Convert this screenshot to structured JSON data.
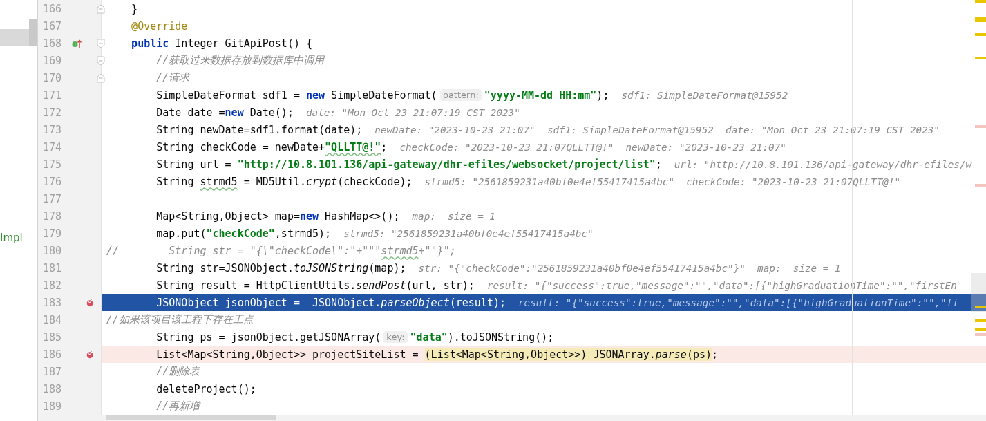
{
  "side_panel": {
    "label": "Impl"
  },
  "lines": [
    {
      "number": "166",
      "override": false,
      "breakpoint": false,
      "current": false,
      "fold_start": false,
      "fold_end": true,
      "tokens": [
        {
          "kind": "plain",
          "text": "    }"
        }
      ]
    },
    {
      "number": "167",
      "override": false,
      "breakpoint": false,
      "current": false,
      "fold_start": false,
      "fold_end": false,
      "tokens": [
        {
          "kind": "annotation",
          "text": "    @Override"
        }
      ]
    },
    {
      "number": "168",
      "override": true,
      "breakpoint": false,
      "current": false,
      "fold_start": true,
      "fold_end": false,
      "tokens": [
        {
          "kind": "keyword",
          "text": "    public"
        },
        {
          "kind": "plain",
          "text": " Integer GitApiPost() {"
        }
      ]
    },
    {
      "number": "169",
      "override": false,
      "breakpoint": false,
      "current": false,
      "fold_start": true,
      "fold_end": false,
      "tokens": [
        {
          "kind": "comment",
          "text": "        //获取过来数据存放到数据库中调用"
        }
      ]
    },
    {
      "number": "170",
      "override": false,
      "breakpoint": false,
      "current": false,
      "fold_start": false,
      "fold_end": true,
      "tokens": [
        {
          "kind": "comment",
          "text": "        //请求"
        }
      ]
    },
    {
      "number": "171",
      "override": false,
      "breakpoint": false,
      "current": false,
      "fold_start": false,
      "fold_end": false,
      "tokens": [
        {
          "kind": "plain",
          "text": "        SimpleDateFormat sdf1 = "
        },
        {
          "kind": "keyword",
          "text": "new"
        },
        {
          "kind": "plain",
          "text": " SimpleDateFormat("
        },
        {
          "kind": "hint",
          "text": "pattern:"
        },
        {
          "kind": "string",
          "text": "\"yyyy-MM-dd HH:mm\""
        },
        {
          "kind": "plain",
          "text": ");"
        },
        {
          "kind": "debug",
          "text": "sdf1: SimpleDateFormat@15952"
        }
      ]
    },
    {
      "number": "172",
      "override": false,
      "breakpoint": false,
      "current": false,
      "fold_start": false,
      "fold_end": false,
      "tokens": [
        {
          "kind": "plain",
          "text": "        Date date ="
        },
        {
          "kind": "keyword",
          "text": "new"
        },
        {
          "kind": "plain",
          "text": " Date();"
        },
        {
          "kind": "debug",
          "text": "date: \"Mon Oct 23 21:07:19 CST 2023\""
        }
      ]
    },
    {
      "number": "173",
      "override": false,
      "breakpoint": false,
      "current": false,
      "fold_start": false,
      "fold_end": false,
      "tokens": [
        {
          "kind": "plain",
          "text": "        String newDate=sdf1.format(date);"
        },
        {
          "kind": "debug",
          "text": "newDate: \"2023-10-23 21:07\"  sdf1: SimpleDateFormat@15952  date: \"Mon Oct 23 21:07:19 CST 2023\""
        }
      ]
    },
    {
      "number": "174",
      "override": false,
      "breakpoint": false,
      "current": false,
      "fold_start": false,
      "fold_end": false,
      "tokens": [
        {
          "kind": "plain",
          "text": "        String checkCode = newDate+"
        },
        {
          "kind": "string-typo",
          "text": "\"QLLTT@!\""
        },
        {
          "kind": "plain",
          "text": ";"
        },
        {
          "kind": "debug",
          "text": "checkCode: \"2023-10-23 21:07QLLTT@!\"  newDate: \"2023-10-23 21:07\""
        }
      ]
    },
    {
      "number": "175",
      "override": false,
      "breakpoint": false,
      "current": false,
      "fold_start": false,
      "fold_end": false,
      "tokens": [
        {
          "kind": "plain",
          "text": "        String url = "
        },
        {
          "kind": "link",
          "text": "\"http://10.8.101.136/api-gateway/dhr-efiles/websocket/project/list\""
        },
        {
          "kind": "plain",
          "text": ";"
        },
        {
          "kind": "debug",
          "text": "url: \"http://10.8.101.136/api-gateway/dhr-efiles/w"
        }
      ]
    },
    {
      "number": "176",
      "override": false,
      "breakpoint": false,
      "current": false,
      "fold_start": false,
      "fold_end": false,
      "tokens": [
        {
          "kind": "plain",
          "text": "        String "
        },
        {
          "kind": "typo",
          "text": "strmd5"
        },
        {
          "kind": "plain",
          "text": " = MD5Util."
        },
        {
          "kind": "italic",
          "text": "crypt"
        },
        {
          "kind": "plain",
          "text": "(checkCode);"
        },
        {
          "kind": "debug",
          "text": "strmd5: \"2561859231a40bf0e4ef55417415a4bc\"  checkCode: \"2023-10-23 21:07QLLTT@!\""
        }
      ]
    },
    {
      "number": "177",
      "override": false,
      "breakpoint": false,
      "current": false,
      "fold_start": false,
      "fold_end": false
    },
    {
      "number": "178",
      "override": false,
      "breakpoint": false,
      "current": false,
      "fold_start": false,
      "fold_end": false,
      "tokens": [
        {
          "kind": "plain",
          "text": "        Map<String,Object> map="
        },
        {
          "kind": "keyword",
          "text": "new"
        },
        {
          "kind": "plain",
          "text": " HashMap<>();"
        },
        {
          "kind": "debug",
          "text": "map:  size = 1"
        }
      ]
    },
    {
      "number": "179",
      "override": false,
      "breakpoint": false,
      "current": false,
      "fold_start": false,
      "fold_end": false,
      "tokens": [
        {
          "kind": "plain",
          "text": "        map.put("
        },
        {
          "kind": "string",
          "text": "\"checkCode\""
        },
        {
          "kind": "plain",
          "text": ",strmd5);"
        },
        {
          "kind": "debug",
          "text": "strmd5: \"2561859231a40bf0e4ef55417415a4bc\""
        }
      ]
    },
    {
      "number": "180",
      "override": false,
      "breakpoint": false,
      "current": false,
      "fold_start": false,
      "fold_end": false,
      "tokens": [
        {
          "kind": "comment",
          "text": "//        String str = \"{\\\"checkCode\\\":\"+\"\"\""
        },
        {
          "kind": "comment-typo",
          "text": "strmd5"
        },
        {
          "kind": "comment",
          "text": "+\"\"}\";"
        }
      ]
    },
    {
      "number": "181",
      "override": false,
      "breakpoint": false,
      "current": false,
      "fold_start": false,
      "fold_end": false,
      "tokens": [
        {
          "kind": "plain",
          "text": "        String str=JSONObject."
        },
        {
          "kind": "italic",
          "text": "toJSONString"
        },
        {
          "kind": "plain",
          "text": "(map);"
        },
        {
          "kind": "debug",
          "text": "str: \"{\"checkCode\":\"2561859231a40bf0e4ef55417415a4bc\"}\"  map:  size = 1"
        }
      ]
    },
    {
      "number": "182",
      "override": false,
      "breakpoint": false,
      "current": false,
      "fold_start": false,
      "fold_end": false,
      "tokens": [
        {
          "kind": "plain",
          "text": "        String result = HttpClientUtils."
        },
        {
          "kind": "italic",
          "text": "sendPost"
        },
        {
          "kind": "plain",
          "text": "(url, str);"
        },
        {
          "kind": "debug",
          "text": "result: \"{\"success\":true,\"message\":\"\",\"data\":[{\"highGraduationTime\":\"\",\"firstEn"
        }
      ]
    },
    {
      "number": "183",
      "override": false,
      "breakpoint": true,
      "current": true,
      "fold_start": false,
      "fold_end": false,
      "tokens": [
        {
          "kind": "plain",
          "text": "        JSONObject jsonObject =  JSONObject."
        },
        {
          "kind": "italic",
          "text": "parseObject"
        },
        {
          "kind": "plain",
          "text": "(result);"
        },
        {
          "kind": "debug",
          "text": "result: \"{\"success\":true,\"message\":\"\",\"data\":[{\"highGraduationTime\":\"\",\"fi"
        }
      ]
    },
    {
      "number": "184",
      "override": false,
      "breakpoint": false,
      "current": false,
      "fold_start": false,
      "fold_end": false,
      "tokens": [
        {
          "kind": "comment",
          "text": "//如果该项目该工程下存在工点"
        }
      ]
    },
    {
      "number": "185",
      "override": false,
      "breakpoint": false,
      "current": false,
      "fold_start": false,
      "fold_end": false,
      "tokens": [
        {
          "kind": "plain",
          "text": "        String ps = jsonObject.getJSONArray("
        },
        {
          "kind": "hint",
          "text": "key:"
        },
        {
          "kind": "string",
          "text": "\"data\""
        },
        {
          "kind": "plain",
          "text": ").toJSONString();"
        }
      ]
    },
    {
      "number": "186",
      "override": false,
      "breakpoint": true,
      "current": false,
      "fold_start": false,
      "fold_end": false,
      "tokens": [
        {
          "kind": "plain",
          "text": "        List<Map<String,Object>> projectSiteList = "
        },
        {
          "kind": "match",
          "text": "(List<Map<String,Object>>) JSONArray."
        },
        {
          "kind": "match-italic",
          "text": "parse"
        },
        {
          "kind": "match",
          "text": "(ps)"
        },
        {
          "kind": "plain",
          "text": ";"
        }
      ]
    },
    {
      "number": "187",
      "override": false,
      "breakpoint": false,
      "current": false,
      "fold_start": false,
      "fold_end": false,
      "tokens": [
        {
          "kind": "comment",
          "text": "        //删除表"
        }
      ]
    },
    {
      "number": "188",
      "override": false,
      "breakpoint": false,
      "current": false,
      "fold_start": false,
      "fold_end": false,
      "tokens": [
        {
          "kind": "plain",
          "text": "        deleteProject();"
        }
      ]
    },
    {
      "number": "189",
      "override": false,
      "breakpoint": false,
      "current": false,
      "fold_start": false,
      "fold_end": false,
      "tokens": [
        {
          "kind": "comment",
          "text": "        //再新增"
        }
      ]
    }
  ]
}
